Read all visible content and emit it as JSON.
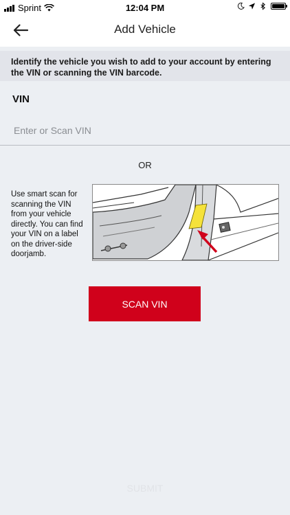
{
  "status_bar": {
    "carrier": "Sprint",
    "time": "12:04 PM"
  },
  "nav": {
    "title": "Add Vehicle"
  },
  "instruction": {
    "text": "Identify the vehicle you wish to add to your account by entering the VIN or scanning the VIN barcode."
  },
  "vin": {
    "label": "VIN",
    "placeholder": "Enter or Scan VIN",
    "value": ""
  },
  "divider_text": "OR",
  "smart_scan": {
    "text": "Use smart scan for scanning the VIN from your vehicle directly. You can find your VIN on a label on the driver-side doorjamb."
  },
  "buttons": {
    "scan_vin": "SCAN VIN",
    "submit": "SUBMIT"
  },
  "colors": {
    "accent": "#d0011b",
    "background": "#eceff3",
    "banner": "#e2e4ea",
    "label_highlight": "#f5e23a"
  }
}
